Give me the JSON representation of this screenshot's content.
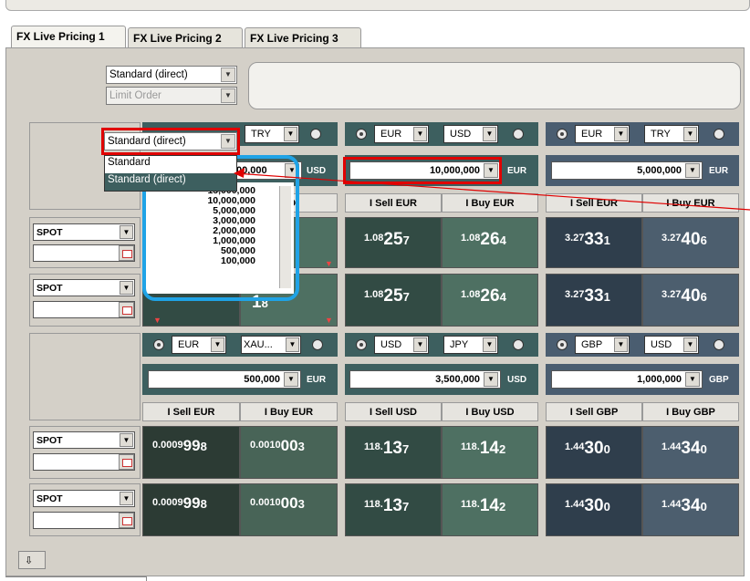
{
  "tabs": [
    {
      "label": "FX Live Pricing 1",
      "active": true
    },
    {
      "label": "FX Live Pricing 2",
      "active": false
    },
    {
      "label": "FX Live Pricing 3",
      "active": false
    }
  ],
  "order_type": {
    "selected": "Standard (direct)",
    "second": "Limit Order"
  },
  "dropdown": {
    "selected": "Standard (direct)",
    "options": [
      "Standard",
      "Standard (direct)"
    ],
    "highlighted": "Standard (direct)"
  },
  "amount_list": [
    "15,000,000",
    "10,000,000",
    "5,000,000",
    "3,000,000",
    "2,000,000",
    "1,000,000",
    "500,000",
    "100,000"
  ],
  "tiles_row1": [
    {
      "base": "",
      "quote": "TRY",
      "amount": "00,000",
      "ccy": "USD",
      "sell_label": "",
      "buy_label": "SD",
      "sell_small": "",
      "sell_big": "",
      "sell_pip": "",
      "buy_small": "",
      "buy_big": "1",
      "buy_pip": "8"
    },
    {
      "base": "EUR",
      "quote": "USD",
      "amount": "10,000,000",
      "ccy": "EUR",
      "sell_label": "I Sell EUR",
      "buy_label": "I Buy EUR",
      "sell_small": "1.08",
      "sell_big": "25",
      "sell_pip": "7",
      "buy_small": "1.08",
      "buy_big": "26",
      "buy_pip": "4"
    },
    {
      "base": "EUR",
      "quote": "TRY",
      "amount": "5,000,000",
      "ccy": "EUR",
      "sell_label": "I Sell EUR",
      "buy_label": "I Buy EUR",
      "sell_small": "3.27",
      "sell_big": "33",
      "sell_pip": "1",
      "buy_small": "3.27",
      "buy_big": "40",
      "buy_pip": "6"
    }
  ],
  "tiles_row2": [
    {
      "base": "EUR",
      "quote": "XAU...",
      "amount": "500,000",
      "ccy": "EUR",
      "sell_label": "I Sell EUR",
      "buy_label": "I Buy EUR",
      "sell_small": "0.0009",
      "sell_big": "99",
      "sell_pip": "8",
      "buy_small": "0.0010",
      "buy_big": "00",
      "buy_pip": "3"
    },
    {
      "base": "USD",
      "quote": "JPY",
      "amount": "3,500,000",
      "ccy": "USD",
      "sell_label": "I Sell USD",
      "buy_label": "I Buy USD",
      "sell_small": "118.",
      "sell_big": "13",
      "sell_pip": "7",
      "buy_small": "118.",
      "buy_big": "14",
      "buy_pip": "2"
    },
    {
      "base": "GBP",
      "quote": "USD",
      "amount": "1,000,000",
      "ccy": "GBP",
      "sell_label": "I Sell GBP",
      "buy_label": "I Buy GBP",
      "sell_small": "1.44",
      "sell_big": "30",
      "sell_pip": "0",
      "buy_small": "1.44",
      "buy_big": "34",
      "buy_pip": "0"
    }
  ],
  "spot_label": "SPOT",
  "tile1_row2_prices": {
    "small": "",
    "big": "1",
    "pip": "8"
  }
}
